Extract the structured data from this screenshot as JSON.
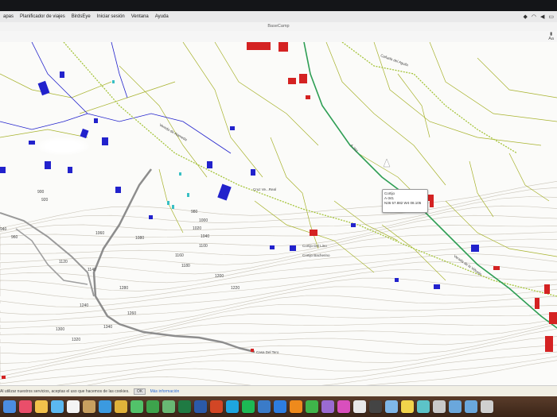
{
  "menubar": {
    "items": [
      "apas",
      "Planificador de viajes",
      "BirdsEye",
      "Iniciar sesión",
      "Ventana",
      "Ayuda"
    ],
    "status_icons": [
      "dropbox-icon",
      "wifi-icon",
      "volume-icon",
      "battery-icon"
    ]
  },
  "window": {
    "title": "BaseCamp"
  },
  "toolbar": {
    "right_label": "Aa"
  },
  "map": {
    "popup_lines": [
      "Cortijo",
      "A-341",
      "N36 57.882 W4 08.105"
    ],
    "places": [
      "Cañada del Aguila",
      "Vereda de Alameda",
      "Cruz Ve...Real",
      "Cortijo Del Lino",
      "Cortijo Bacherino",
      "Casa Del Tero"
    ],
    "road_labels": [
      "A-341",
      "Vereda de Alameda",
      "Verada de la Viñuela",
      "Viceda De Teba Al Alcázar De Fuengirola"
    ],
    "contours": [
      "900",
      "920",
      "940",
      "960",
      "980",
      "1000",
      "1020",
      "1040",
      "1060",
      "1080",
      "1100",
      "1120",
      "1140",
      "1160",
      "1180",
      "1200",
      "1220",
      "1240",
      "1260",
      "1280",
      "1300",
      "1320",
      "1340"
    ]
  },
  "cookie_bar": {
    "text": "Al utilizar nuestros servicios, aceptas el uso que hacemos de las cookies.",
    "ok_label": "OK",
    "more_label": "Más información"
  },
  "colors": {
    "road_green": "#2e9e54",
    "water_blue": "#2222cc",
    "building_red": "#d42222",
    "track_gray": "#8d8d8d",
    "contour": "#c9c4b8"
  }
}
